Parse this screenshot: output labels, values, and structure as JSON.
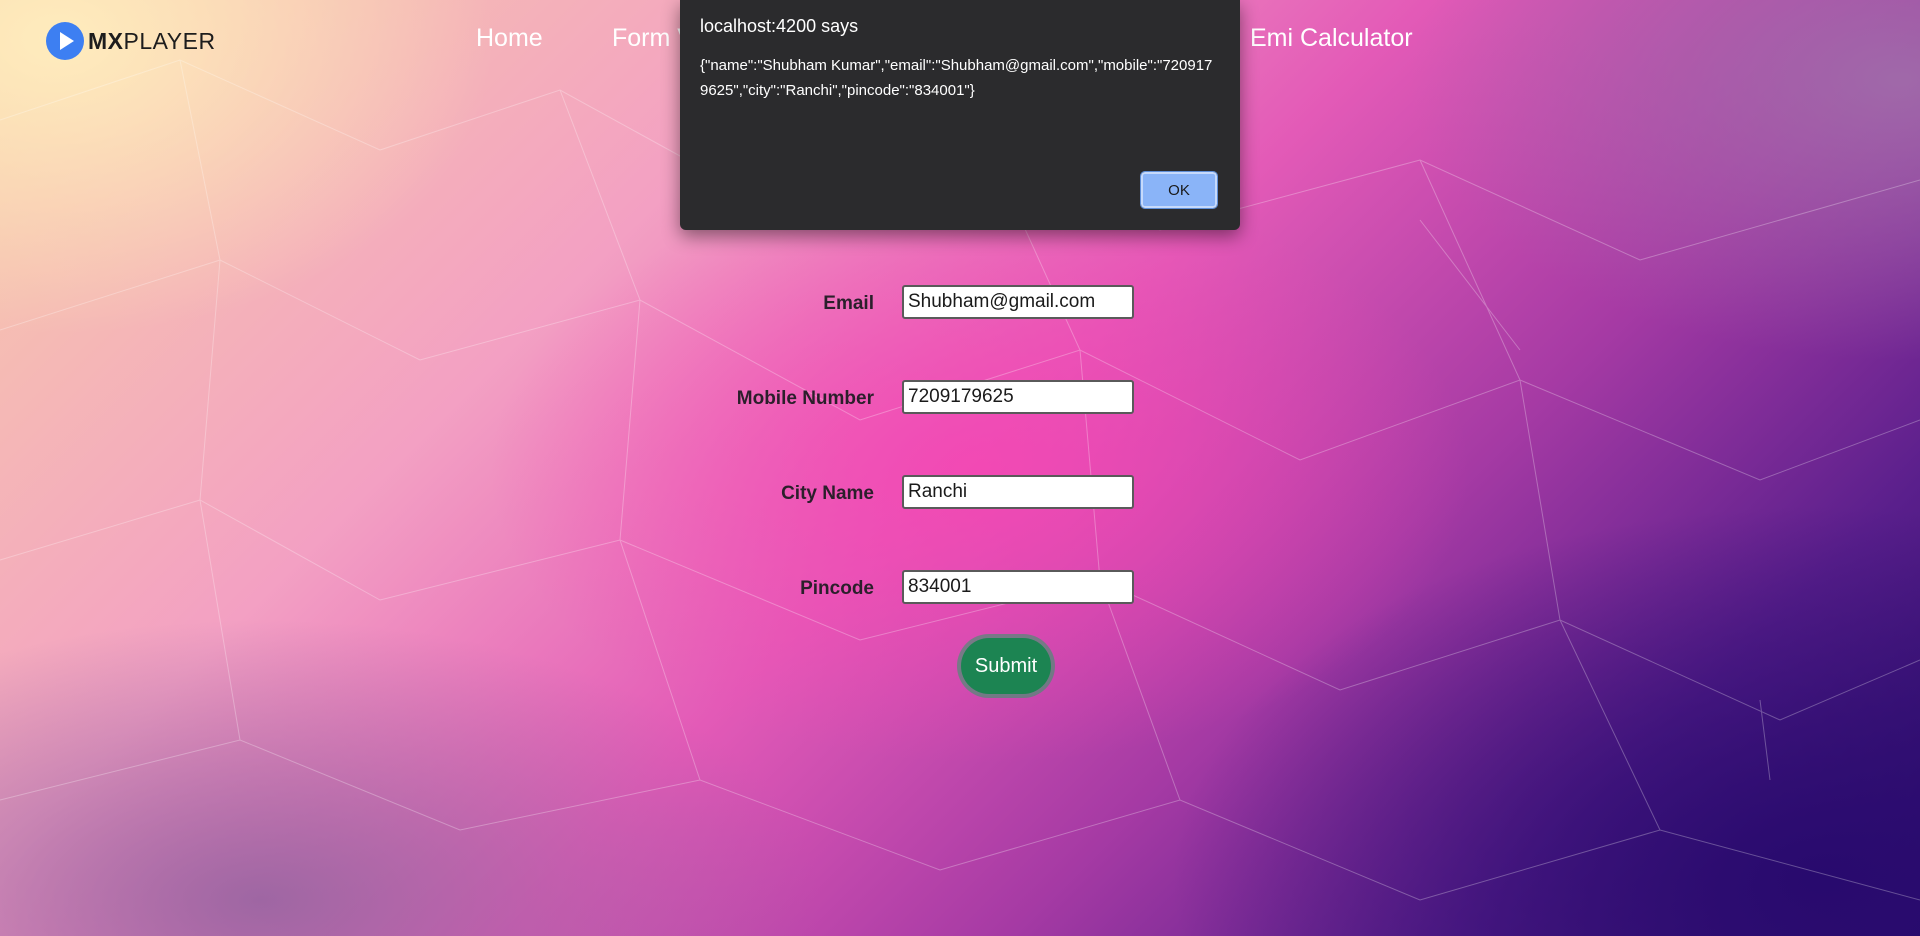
{
  "brand": {
    "icon": "play-icon",
    "name_bold": "MX",
    "name_rest": "PLAYER"
  },
  "nav": {
    "home": "Home",
    "form": "Form V",
    "emi": "Emi Calculator"
  },
  "form": {
    "email_label": "Email",
    "email_value": "Shubham@gmail.com",
    "mobile_label": "Mobile Number",
    "mobile_value": "7209179625",
    "city_label": "City Name",
    "city_value": "Ranchi",
    "pincode_label": "Pincode",
    "pincode_value": "834001",
    "submit_label": "Submit"
  },
  "alert": {
    "title": "localhost:4200 says",
    "message": "{\"name\":\"Shubham Kumar\",\"email\":\"Shubham@gmail.com\",\"mobile\":\"7209179625\",\"city\":\"Ranchi\",\"pincode\":\"834001\"}",
    "ok_label": "OK"
  },
  "colors": {
    "submit_bg": "#1c8452",
    "ok_bg": "#8ab4f8",
    "dialog_bg": "#2b2b2d",
    "brand_blue": "#3d7ff2"
  }
}
